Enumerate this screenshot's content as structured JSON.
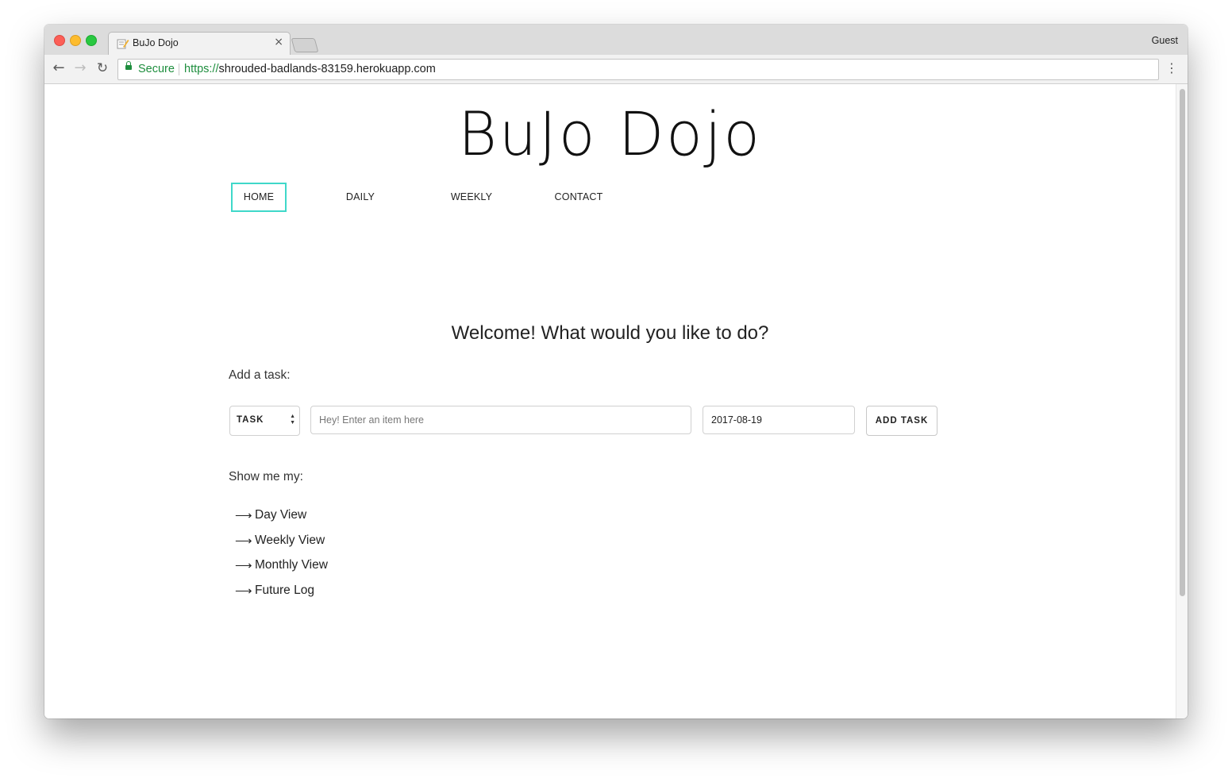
{
  "browser": {
    "tab_title": "BuJo Dojo",
    "tab_close": "×",
    "profile": "Guest",
    "secure_label": "Secure",
    "url_scheme": "https://",
    "url_host": "shrouded-badlands-83159.herokuapp.com"
  },
  "site": {
    "logo": "BuJo Dojo",
    "nav": {
      "home": "HOME",
      "daily": "DAILY",
      "weekly": "WEEKLY",
      "contact": "CONTACT",
      "active": "HOME",
      "active_border_color": "#3fd8c9"
    },
    "welcome": "Welcome! What would you like to do?",
    "add_task": {
      "label": "Add a task:",
      "type_select_value": "TASK",
      "item_placeholder": "Hey! Enter an item here",
      "date_value": "2017-08-19",
      "button_label": "ADD TASK"
    },
    "show_me": {
      "label": "Show me my:",
      "links": [
        "Day View",
        "Weekly View",
        "Monthly View",
        "Future Log"
      ]
    }
  },
  "icons": {
    "list_arrow": "⟶",
    "back": "←",
    "forward": "→",
    "reload": "↻",
    "menu": "⋮"
  }
}
